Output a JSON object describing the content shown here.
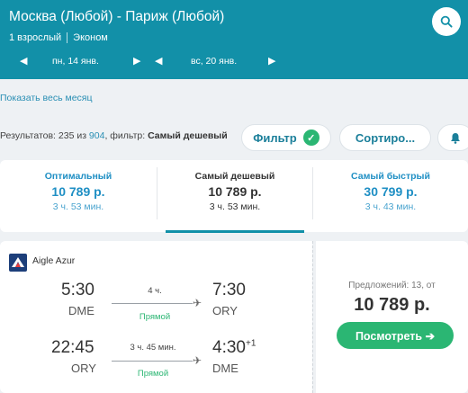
{
  "header": {
    "route": "Москва (Любой) - Париж (Любой)",
    "passengers": "1 взрослый",
    "cabin": "Эконом",
    "date_out": "пн, 14 янв.",
    "date_back": "вс, 20 янв.",
    "search_icon": "search-icon",
    "prev_icon": "◀",
    "next_icon": "▶"
  },
  "month_link": "Показать весь месяц",
  "results": {
    "prefix": "Результатов: 235 из ",
    "total": "904",
    "filter_prefix": ", фильтр: ",
    "filter_value": "Самый дешевый"
  },
  "toolbar": {
    "filter_label": "Фильтр",
    "filter_check": "✓",
    "sort_label": "Сортиро...",
    "bell_icon": "bell-icon"
  },
  "tabs": [
    {
      "title": "Оптимальный",
      "price": "10 789 р.",
      "duration": "3 ч. 53 мин."
    },
    {
      "title": "Самый дешевый",
      "price": "10 789 р.",
      "duration": "3 ч. 53 мин."
    },
    {
      "title": "Самый быстрый",
      "price": "30 799 р.",
      "duration": "3 ч. 43 мин."
    }
  ],
  "flight": {
    "airline": "Aigle Azur",
    "outbound": {
      "dep_time": "5:30",
      "dep_code": "DME",
      "arr_time": "7:30",
      "arr_code": "ORY",
      "duration": "4 ч.",
      "stops": "Прямой",
      "plus": ""
    },
    "inbound": {
      "dep_time": "22:45",
      "dep_code": "ORY",
      "arr_time": "4:30",
      "arr_code": "DME",
      "duration": "3 ч. 45 мин.",
      "stops": "Прямой",
      "plus": "+1"
    },
    "offers": "Предложений: 13, от",
    "price": "10 789 р.",
    "button_label": "Посмотреть ➔"
  },
  "colors": {
    "header": "#1290a8",
    "accent_green": "#2bb673",
    "link_blue": "#2a8fb4"
  }
}
